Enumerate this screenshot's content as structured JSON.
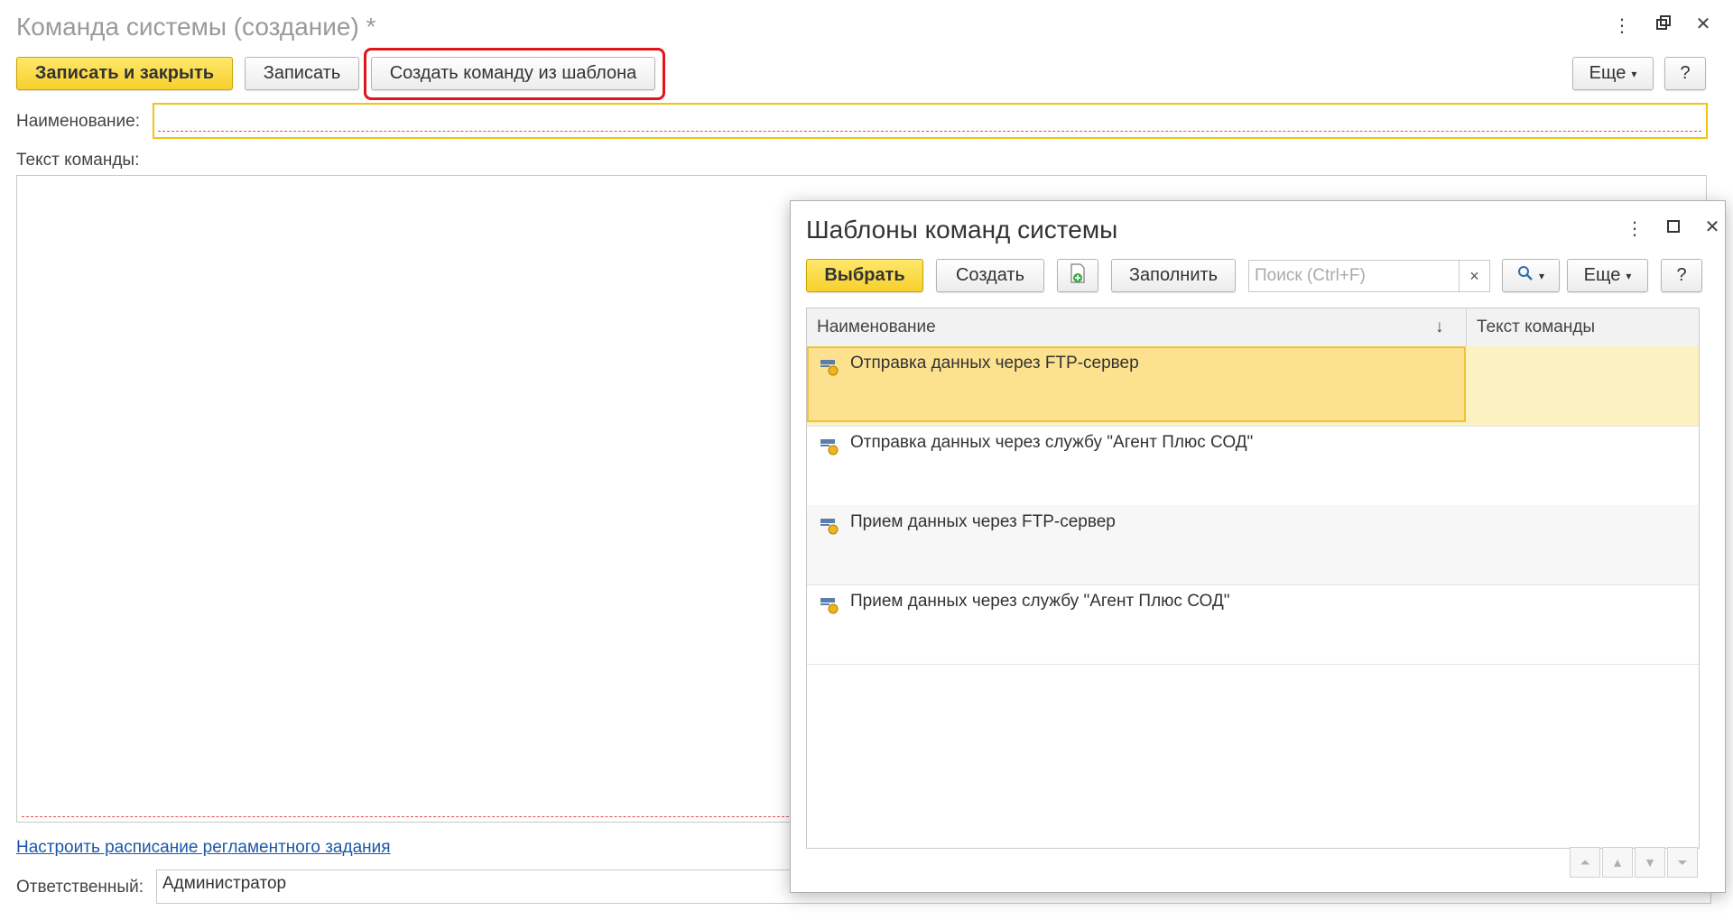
{
  "form": {
    "title": "Команда системы (создание) *",
    "toolbar": {
      "save_close": "Записать и закрыть",
      "save": "Записать",
      "create_from_template": "Создать команду из шаблона",
      "more": "Еще",
      "help": "?"
    },
    "name_label": "Наименование:",
    "name_value": "",
    "command_text_label": "Текст команды:",
    "schedule_link": "Настроить расписание регламентного задания",
    "responsible_label": "Ответственный:",
    "responsible_value": "Администратор"
  },
  "dialog": {
    "title": "Шаблоны команд системы",
    "toolbar": {
      "select": "Выбрать",
      "create": "Создать",
      "fill": "Заполнить",
      "search_placeholder": "Поиск (Ctrl+F)",
      "clear": "×",
      "more": "Еще",
      "help": "?"
    },
    "columns": [
      "Наименование",
      "Текст команды"
    ],
    "sort_indicator": "↓",
    "rows": [
      "Отправка данных через FTP-сервер",
      "Отправка данных через службу \"Агент Плюс СОД\"",
      "Прием данных через FTP-сервер",
      "Прием данных через службу \"Агент Плюс СОД\""
    ],
    "selected_row": 0
  },
  "colors": {
    "accent_yellow": "#f7d02c",
    "highlight_red": "#e0141b",
    "link_blue": "#1a57a8",
    "selection": "#fce28f"
  },
  "icons": [
    "kebab-menu-icon",
    "restore-window-icon",
    "close-icon",
    "maximize-icon",
    "add-copy-icon",
    "search-icon",
    "chevron-down-icon",
    "template-item-icon"
  ]
}
